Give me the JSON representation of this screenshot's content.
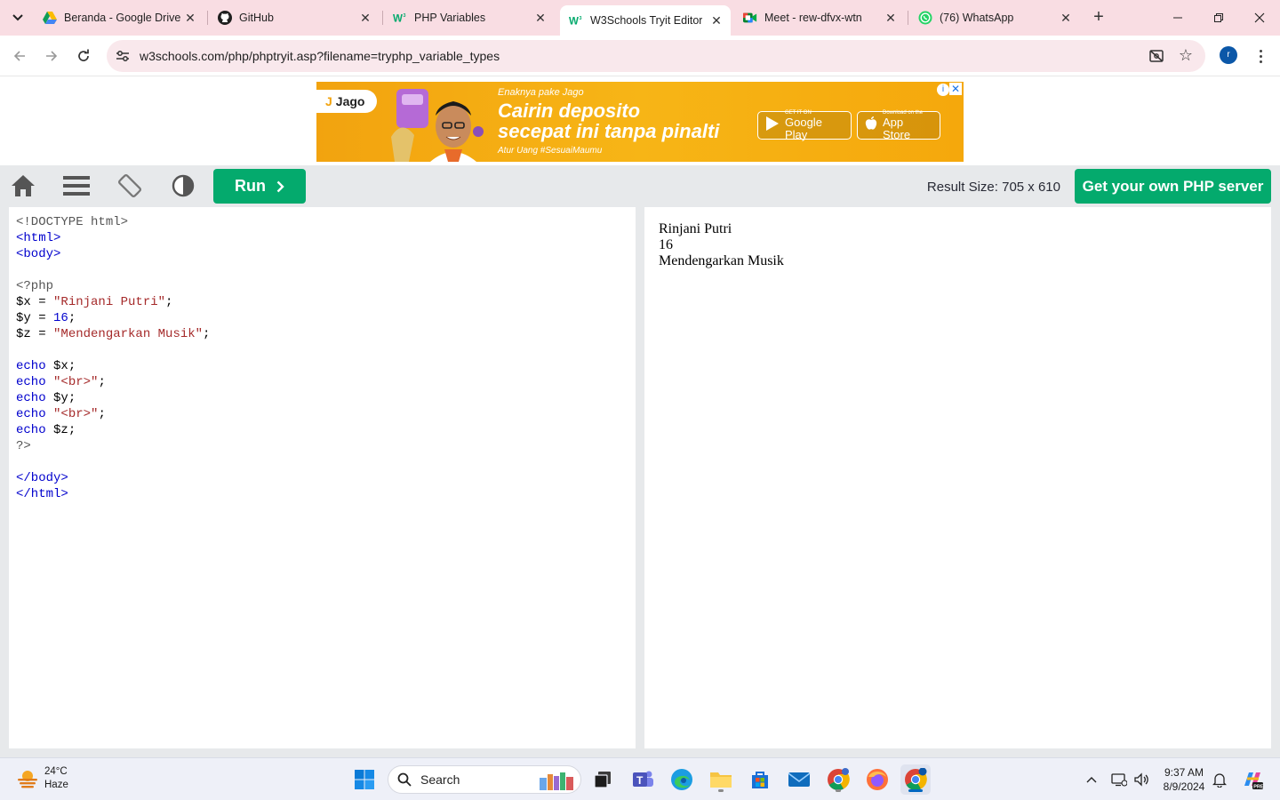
{
  "browser": {
    "tabs": [
      {
        "title": "Beranda - Google Drive",
        "icon": "google-drive-icon"
      },
      {
        "title": "GitHub",
        "icon": "github-icon"
      },
      {
        "title": "PHP Variables",
        "icon": "w3schools-icon"
      },
      {
        "title": "W3Schools Tryit Editor",
        "icon": "w3schools-icon",
        "active": true
      },
      {
        "title": "Meet - rew-dfvx-wtn",
        "icon": "google-meet-icon"
      },
      {
        "title": "(76) WhatsApp",
        "icon": "whatsapp-icon"
      }
    ],
    "url": "w3schools.com/php/phptryit.asp?filename=tryphp_variable_types",
    "profile_initial": "r"
  },
  "ad": {
    "brand": "Jago",
    "tagline": "Enaknya pake Jago",
    "headline_1": "Cairin deposito",
    "headline_2": "secepat ini tanpa pinalti",
    "subline": "Atur Uang #SesuaiMaumu",
    "google_play_small": "GET IT ON",
    "google_play_big": "Google Play",
    "app_store_small": "Download on the",
    "app_store_big": "App Store",
    "accent_color": "#f2a30f"
  },
  "tryit": {
    "run_label": "Run",
    "result_size": "Result Size: 705 x 610",
    "get_server_label": "Get your own PHP server",
    "accent_color": "#04aa6d",
    "code_lines": [
      [
        {
          "t": "<!DOCTYPE html>",
          "c": "c-doc"
        }
      ],
      [
        {
          "t": "<html>",
          "c": "c-tag"
        }
      ],
      [
        {
          "t": "<body>",
          "c": "c-tag"
        }
      ],
      [],
      [
        {
          "t": "<?php",
          "c": "c-php"
        }
      ],
      [
        {
          "t": "$x = ",
          "c": ""
        },
        {
          "t": "\"Rinjani Putri\"",
          "c": "c-str"
        },
        {
          "t": ";",
          "c": ""
        }
      ],
      [
        {
          "t": "$y = ",
          "c": ""
        },
        {
          "t": "16",
          "c": "c-num"
        },
        {
          "t": ";",
          "c": ""
        }
      ],
      [
        {
          "t": "$z = ",
          "c": ""
        },
        {
          "t": "\"Mendengarkan Musik\"",
          "c": "c-str"
        },
        {
          "t": ";",
          "c": ""
        }
      ],
      [],
      [
        {
          "t": "echo",
          "c": "c-kw"
        },
        {
          "t": " $x;",
          "c": ""
        }
      ],
      [
        {
          "t": "echo",
          "c": "c-kw"
        },
        {
          "t": " ",
          "c": ""
        },
        {
          "t": "\"<br>\"",
          "c": "c-str"
        },
        {
          "t": ";",
          "c": ""
        }
      ],
      [
        {
          "t": "echo",
          "c": "c-kw"
        },
        {
          "t": " $y;",
          "c": ""
        }
      ],
      [
        {
          "t": "echo",
          "c": "c-kw"
        },
        {
          "t": " ",
          "c": ""
        },
        {
          "t": "\"<br>\"",
          "c": "c-str"
        },
        {
          "t": ";",
          "c": ""
        }
      ],
      [
        {
          "t": "echo",
          "c": "c-kw"
        },
        {
          "t": " $z;",
          "c": ""
        }
      ],
      [
        {
          "t": "?>",
          "c": "c-php"
        }
      ],
      [],
      [
        {
          "t": "</body>",
          "c": "c-tag"
        }
      ],
      [
        {
          "t": "</html>",
          "c": "c-tag"
        }
      ]
    ],
    "result_lines": [
      "Rinjani Putri",
      "16",
      "Mendengarkan Musik"
    ]
  },
  "taskbar": {
    "weather_temp": "24°C",
    "weather_desc": "Haze",
    "search_placeholder": "Search",
    "time": "9:37 AM",
    "date": "8/9/2024"
  }
}
